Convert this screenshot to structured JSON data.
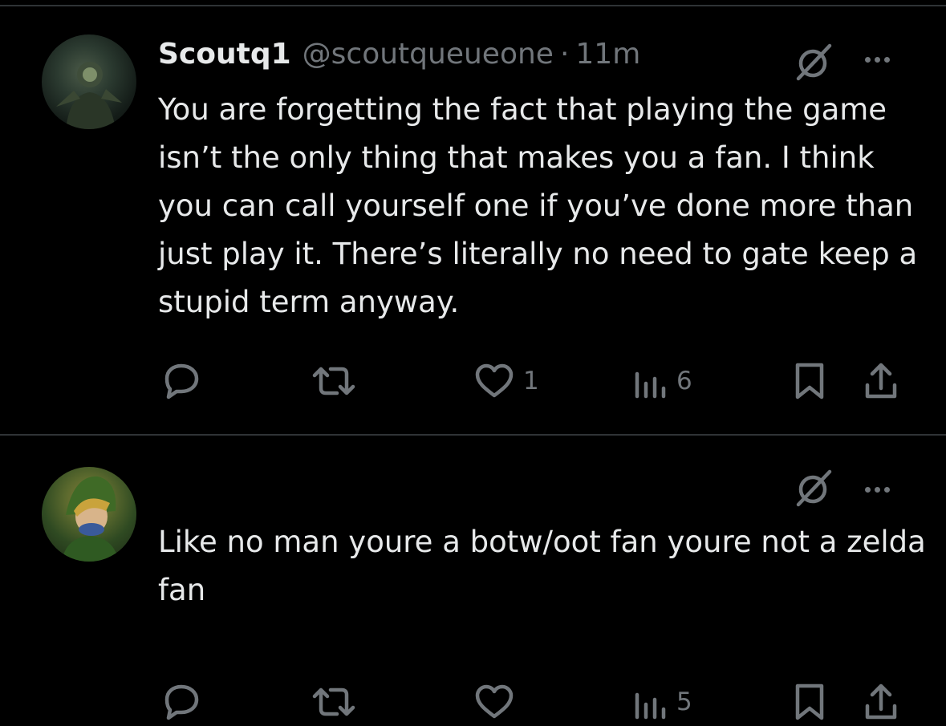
{
  "tweets": [
    {
      "display_name": "Scoutq1",
      "handle": "@scoutqueueone",
      "separator": "·",
      "time": "11m",
      "text": "You are forgetting the fact that playing the game isn’t the only thing that makes you a fan. I think you can call yourself one if you’ve done more than just play it. There’s literally no need to gate keep a stupid term anyway.",
      "likes": "1",
      "views": "6"
    },
    {
      "display_name": "",
      "handle": "",
      "separator": "",
      "time": "",
      "text": "Like no man youre a botw/oot fan youre not a zelda fan",
      "likes": "",
      "views": "5"
    }
  ],
  "icons": {
    "reply": "reply-icon",
    "retweet": "retweet-icon",
    "like": "heart-icon",
    "views": "views-icon",
    "bookmark": "bookmark-icon",
    "share": "share-icon",
    "grok": "grok-icon",
    "more": "more-icon"
  },
  "colors": {
    "background": "#000000",
    "text": "#e7e9ea",
    "muted": "#71767b",
    "divider": "#2f3336"
  }
}
